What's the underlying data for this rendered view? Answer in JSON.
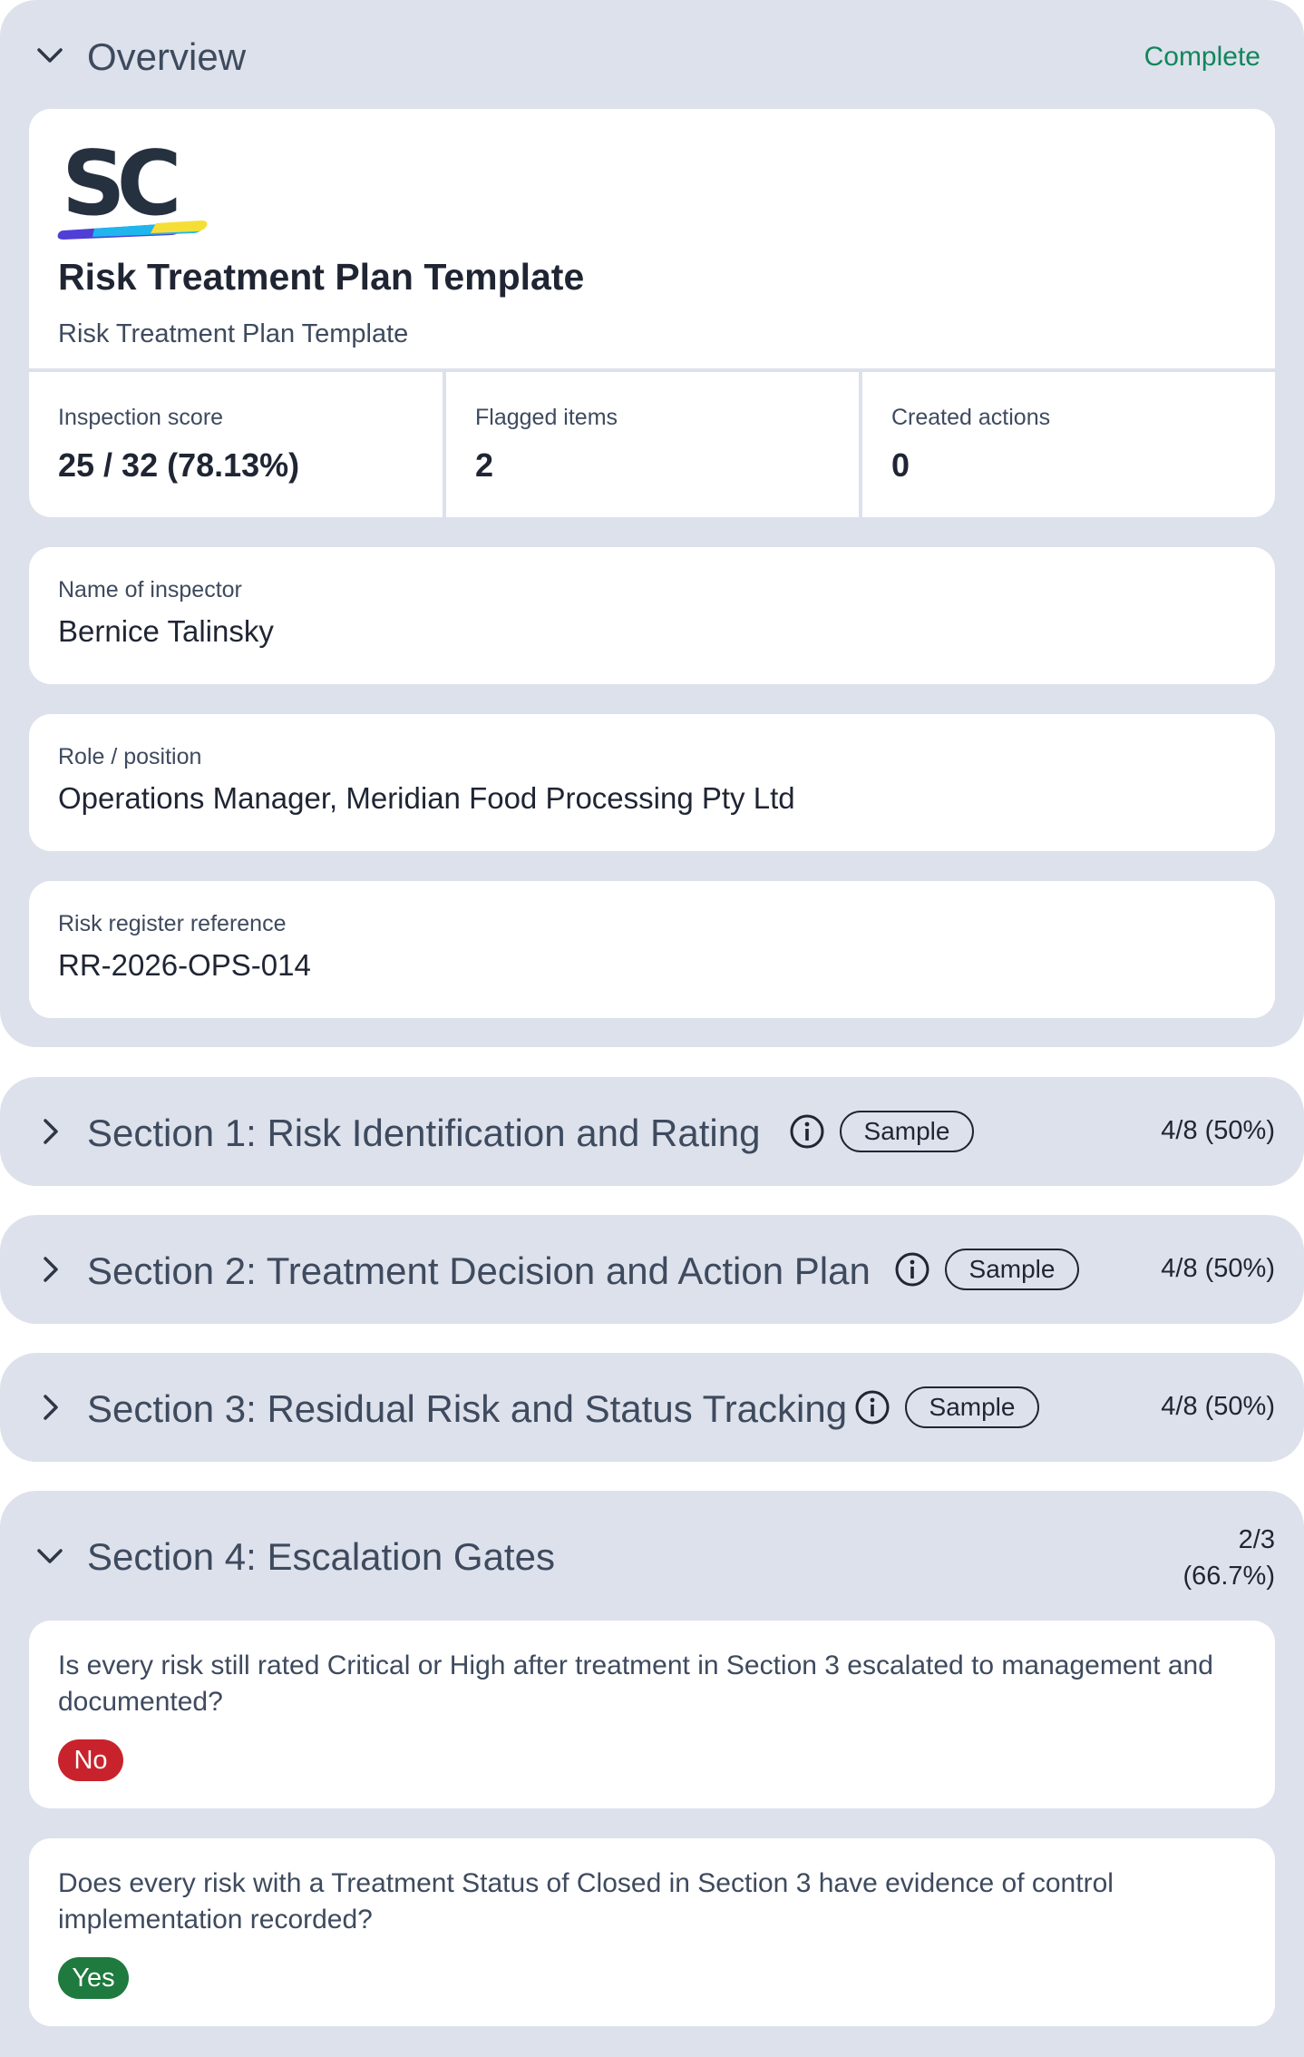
{
  "overview": {
    "title": "Overview",
    "status": "Complete",
    "logo_text": "SC",
    "template_title": "Risk Treatment Plan Template",
    "template_subtitle": "Risk Treatment Plan Template",
    "stats": [
      {
        "label": "Inspection score",
        "value": "25 / 32 (78.13%)"
      },
      {
        "label": "Flagged items",
        "value": "2"
      },
      {
        "label": "Created actions",
        "value": "0"
      }
    ],
    "fields": [
      {
        "label": "Name of inspector",
        "value": "Bernice Talinsky"
      },
      {
        "label": "Role / position",
        "value": "Operations Manager, Meridian Food Processing Pty Ltd"
      },
      {
        "label": "Risk register reference",
        "value": "RR-2026-OPS-014"
      }
    ]
  },
  "sections": [
    {
      "title": "Section 1: Risk Identification and Rating",
      "tag": "Sample",
      "score": "4/8 (50%)"
    },
    {
      "title": "Section 2: Treatment Decision and Action Plan",
      "tag": "Sample",
      "score": "4/8 (50%)"
    },
    {
      "title": "Section 3: Residual Risk and Status Tracking",
      "tag": "Sample",
      "score": "4/8 (50%)"
    }
  ],
  "section4": {
    "title": "Section 4: Escalation Gates",
    "score_line1": "2/3",
    "score_line2": "(66.7%)",
    "questions": [
      {
        "text": "Is every risk still rated Critical or High after treatment in Section 3 escalated to management and documented?",
        "answer": "No"
      },
      {
        "text": "Does every risk with a Treatment Status of Closed in Section 3 have evidence of control implementation recorded?",
        "answer": "Yes"
      }
    ]
  },
  "colors": {
    "panel_bg": "#dde1eb",
    "complete_text": "#13855c",
    "answer_no": "#c8232c",
    "answer_yes": "#1e7a3e"
  },
  "icons": [
    "chevron-down-icon",
    "chevron-right-icon",
    "info-icon"
  ]
}
